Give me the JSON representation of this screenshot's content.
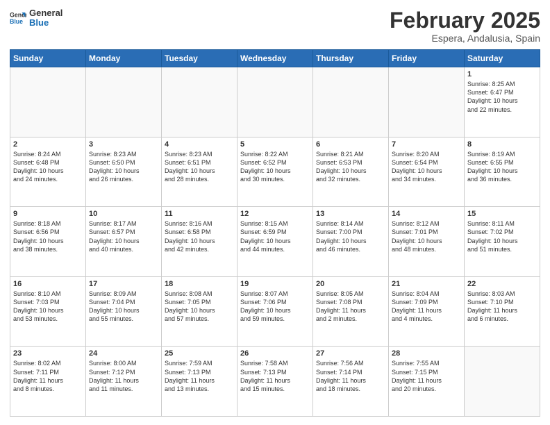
{
  "header": {
    "logo_line1": "General",
    "logo_line2": "Blue",
    "month": "February 2025",
    "location": "Espera, Andalusia, Spain"
  },
  "weekdays": [
    "Sunday",
    "Monday",
    "Tuesday",
    "Wednesday",
    "Thursday",
    "Friday",
    "Saturday"
  ],
  "weeks": [
    [
      {
        "day": "",
        "info": ""
      },
      {
        "day": "",
        "info": ""
      },
      {
        "day": "",
        "info": ""
      },
      {
        "day": "",
        "info": ""
      },
      {
        "day": "",
        "info": ""
      },
      {
        "day": "",
        "info": ""
      },
      {
        "day": "1",
        "info": "Sunrise: 8:25 AM\nSunset: 6:47 PM\nDaylight: 10 hours\nand 22 minutes."
      }
    ],
    [
      {
        "day": "2",
        "info": "Sunrise: 8:24 AM\nSunset: 6:48 PM\nDaylight: 10 hours\nand 24 minutes."
      },
      {
        "day": "3",
        "info": "Sunrise: 8:23 AM\nSunset: 6:50 PM\nDaylight: 10 hours\nand 26 minutes."
      },
      {
        "day": "4",
        "info": "Sunrise: 8:23 AM\nSunset: 6:51 PM\nDaylight: 10 hours\nand 28 minutes."
      },
      {
        "day": "5",
        "info": "Sunrise: 8:22 AM\nSunset: 6:52 PM\nDaylight: 10 hours\nand 30 minutes."
      },
      {
        "day": "6",
        "info": "Sunrise: 8:21 AM\nSunset: 6:53 PM\nDaylight: 10 hours\nand 32 minutes."
      },
      {
        "day": "7",
        "info": "Sunrise: 8:20 AM\nSunset: 6:54 PM\nDaylight: 10 hours\nand 34 minutes."
      },
      {
        "day": "8",
        "info": "Sunrise: 8:19 AM\nSunset: 6:55 PM\nDaylight: 10 hours\nand 36 minutes."
      }
    ],
    [
      {
        "day": "9",
        "info": "Sunrise: 8:18 AM\nSunset: 6:56 PM\nDaylight: 10 hours\nand 38 minutes."
      },
      {
        "day": "10",
        "info": "Sunrise: 8:17 AM\nSunset: 6:57 PM\nDaylight: 10 hours\nand 40 minutes."
      },
      {
        "day": "11",
        "info": "Sunrise: 8:16 AM\nSunset: 6:58 PM\nDaylight: 10 hours\nand 42 minutes."
      },
      {
        "day": "12",
        "info": "Sunrise: 8:15 AM\nSunset: 6:59 PM\nDaylight: 10 hours\nand 44 minutes."
      },
      {
        "day": "13",
        "info": "Sunrise: 8:14 AM\nSunset: 7:00 PM\nDaylight: 10 hours\nand 46 minutes."
      },
      {
        "day": "14",
        "info": "Sunrise: 8:12 AM\nSunset: 7:01 PM\nDaylight: 10 hours\nand 48 minutes."
      },
      {
        "day": "15",
        "info": "Sunrise: 8:11 AM\nSunset: 7:02 PM\nDaylight: 10 hours\nand 51 minutes."
      }
    ],
    [
      {
        "day": "16",
        "info": "Sunrise: 8:10 AM\nSunset: 7:03 PM\nDaylight: 10 hours\nand 53 minutes."
      },
      {
        "day": "17",
        "info": "Sunrise: 8:09 AM\nSunset: 7:04 PM\nDaylight: 10 hours\nand 55 minutes."
      },
      {
        "day": "18",
        "info": "Sunrise: 8:08 AM\nSunset: 7:05 PM\nDaylight: 10 hours\nand 57 minutes."
      },
      {
        "day": "19",
        "info": "Sunrise: 8:07 AM\nSunset: 7:06 PM\nDaylight: 10 hours\nand 59 minutes."
      },
      {
        "day": "20",
        "info": "Sunrise: 8:05 AM\nSunset: 7:08 PM\nDaylight: 11 hours\nand 2 minutes."
      },
      {
        "day": "21",
        "info": "Sunrise: 8:04 AM\nSunset: 7:09 PM\nDaylight: 11 hours\nand 4 minutes."
      },
      {
        "day": "22",
        "info": "Sunrise: 8:03 AM\nSunset: 7:10 PM\nDaylight: 11 hours\nand 6 minutes."
      }
    ],
    [
      {
        "day": "23",
        "info": "Sunrise: 8:02 AM\nSunset: 7:11 PM\nDaylight: 11 hours\nand 8 minutes."
      },
      {
        "day": "24",
        "info": "Sunrise: 8:00 AM\nSunset: 7:12 PM\nDaylight: 11 hours\nand 11 minutes."
      },
      {
        "day": "25",
        "info": "Sunrise: 7:59 AM\nSunset: 7:13 PM\nDaylight: 11 hours\nand 13 minutes."
      },
      {
        "day": "26",
        "info": "Sunrise: 7:58 AM\nSunset: 7:13 PM\nDaylight: 11 hours\nand 15 minutes."
      },
      {
        "day": "27",
        "info": "Sunrise: 7:56 AM\nSunset: 7:14 PM\nDaylight: 11 hours\nand 18 minutes."
      },
      {
        "day": "28",
        "info": "Sunrise: 7:55 AM\nSunset: 7:15 PM\nDaylight: 11 hours\nand 20 minutes."
      },
      {
        "day": "",
        "info": ""
      }
    ]
  ]
}
